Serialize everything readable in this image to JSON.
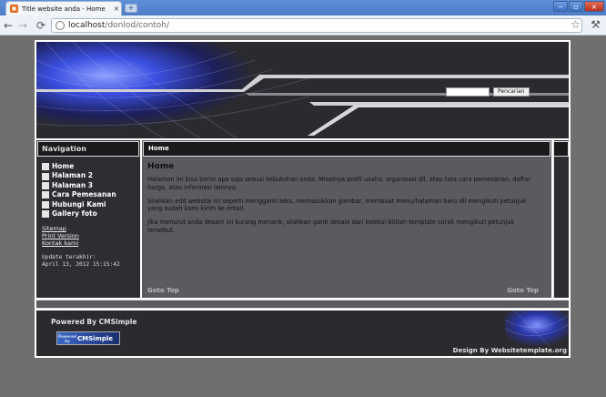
{
  "browser": {
    "tab_title": "Title website anda - Home",
    "favicon": "CMS",
    "tab_close": "×",
    "new_tab": "+",
    "url_host": "localhost",
    "url_path": "/donlod/contoh/",
    "win_min": "‒",
    "win_max": "▫",
    "win_close": "×",
    "icons": {
      "back": "arrow-left",
      "forward": "arrow-right",
      "reload": "reload",
      "bookmark": "star",
      "menu": "wrench"
    }
  },
  "site": {
    "search": {
      "value": "",
      "button_label": "Pencarian"
    },
    "sidebar": {
      "heading": "Navigation",
      "items": [
        {
          "label": "Home"
        },
        {
          "label": "Halaman 2"
        },
        {
          "label": "Halaman 3"
        },
        {
          "label": "Cara Pemesanan"
        },
        {
          "label": "Hubungi Kami"
        },
        {
          "label": "Gallery foto"
        }
      ],
      "links": [
        "Sitemap",
        "Print Version",
        "Kontak kami"
      ],
      "update_label": "Update terakhir:",
      "update_date": "April 13, 2012 15:15:42"
    },
    "content": {
      "breadcrumb": "Home",
      "title": "Home",
      "paragraphs": [
        "Halaman ini bisa berisi apa saja sesuai kebutuhan anda. Misalnya profil usaha, organisasi dll, atau tata cara pemesanan, daftar harga, atau informasi lainnya.",
        "Silahkan edit website ini seperti mengganti teks, memasukkan gambar, membuat menu/halaman baru dll mengikuti petunjuk yang sudah kami kirim ke email.",
        "Jika menurut anda desain ini kurang menarik, silahkan ganti desain dari koleksi 600an template corak mengikuti petunjuk tersebut."
      ],
      "goto_left": "Goto Top",
      "goto_right": "Goto Top"
    },
    "footer": {
      "powered": "Powered By CMSimple",
      "badge_small": "Powered by",
      "badge_text": "CMSimple",
      "design": "Design By Websitetemplate.org"
    },
    "colors": {
      "frame": "#2b2b2f",
      "content_bg": "#5b5b5f",
      "accent_blue": "#3b4fe0"
    }
  }
}
